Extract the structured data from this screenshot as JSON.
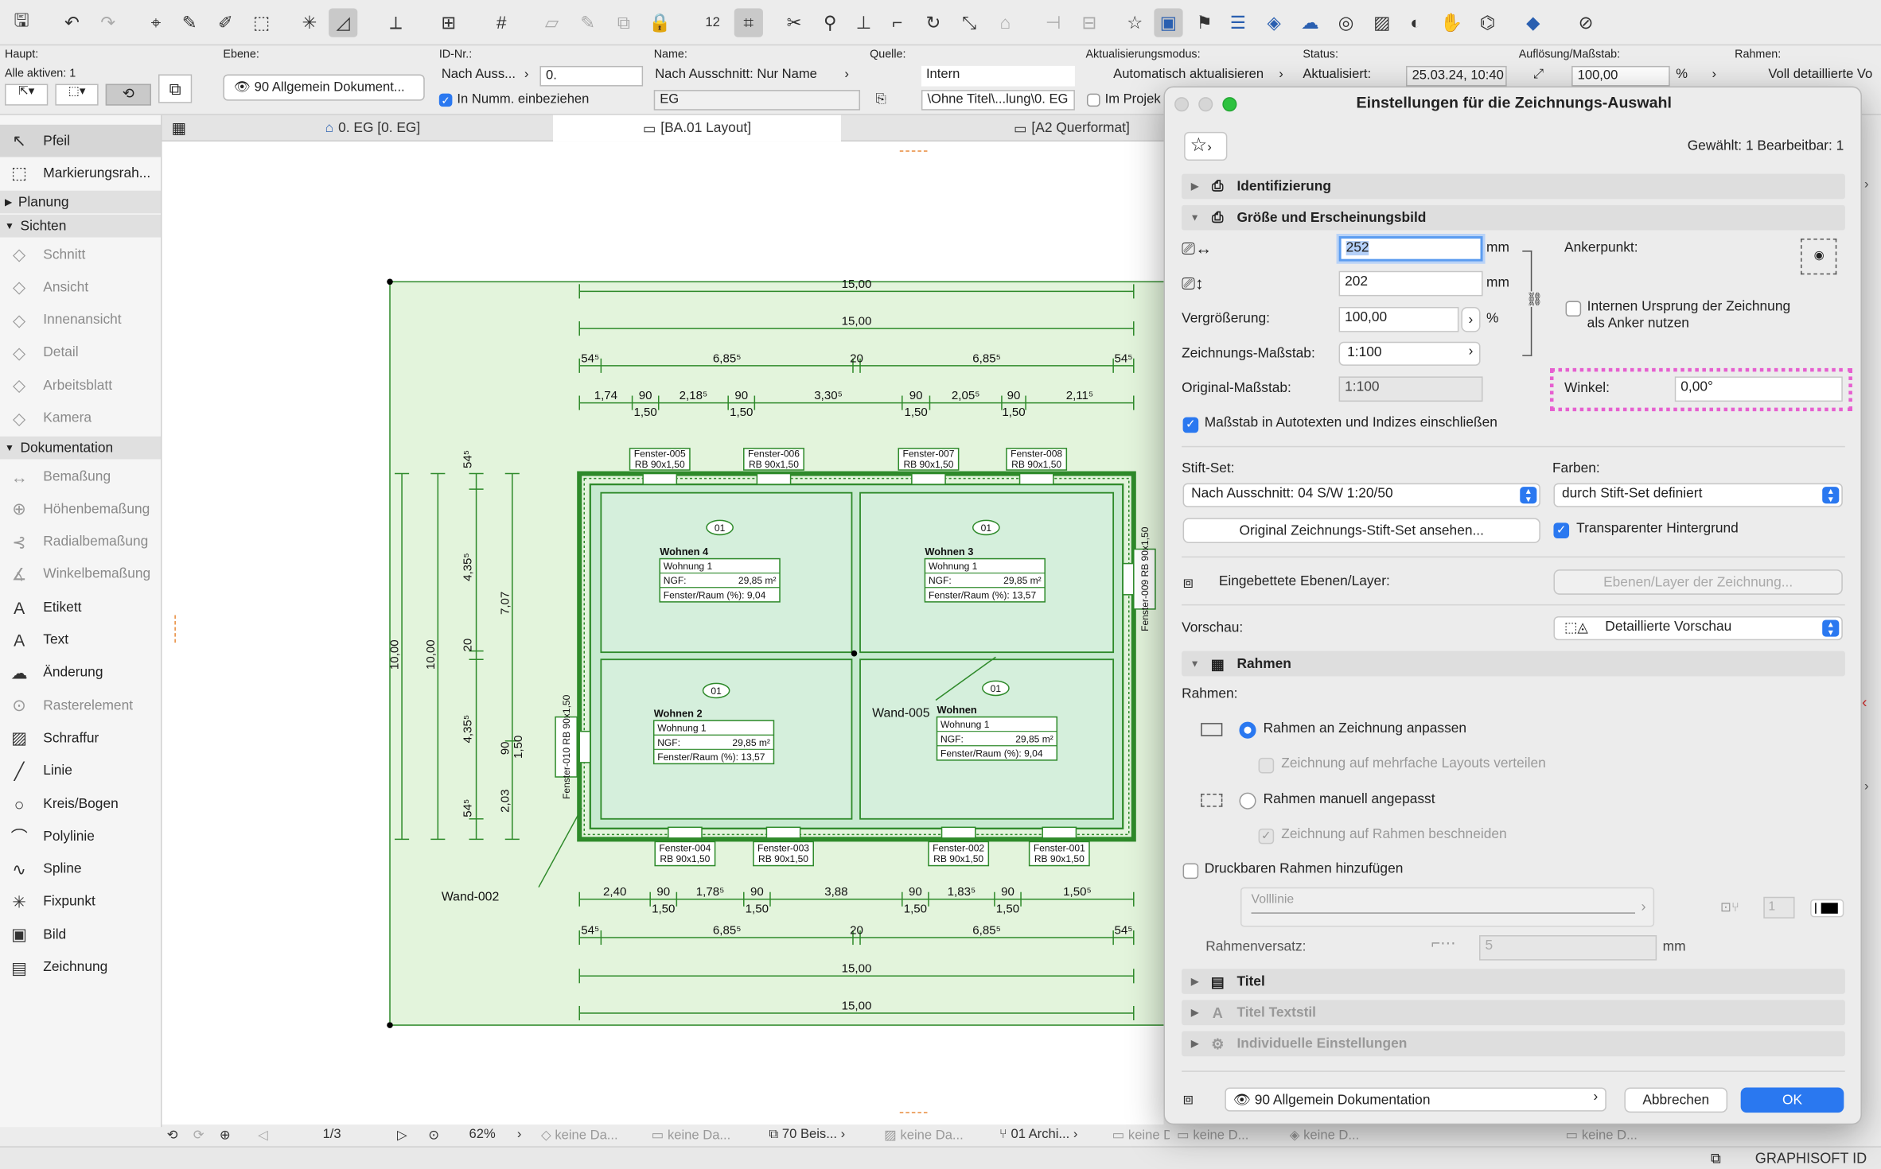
{
  "toolbar": {
    "icons": [
      "save-icon",
      "undo-icon",
      "redo-icon",
      "select-icon",
      "pick-icon",
      "inject-icon",
      "transform-icon",
      "cursor-icon",
      "guide-icon",
      "snap-icon",
      "grid-icon",
      "layer-icon",
      "lock-icon",
      "number-icon",
      "selection-icon",
      "trim-icon",
      "magic-icon",
      "elevate-icon",
      "offset-icon",
      "rotate-icon",
      "scale-icon",
      "favorites-icon",
      "flag-icon",
      "stack-icon",
      "graphics-icon"
    ]
  },
  "infobox": {
    "haupt_label": "Haupt:",
    "alle_aktiven": "Alle aktiven: 1",
    "ebene_label": "Ebene:",
    "ebene_value": "90 Allgemein Dokument...",
    "id_label": "ID-Nr.:",
    "id_by": "Nach Auss...",
    "id_value": "0.",
    "in_numm": "In Numm. einbeziehen",
    "name_label": "Name:",
    "name_by": "Nach Ausschnitt: Nur Name",
    "name_value": "EG",
    "quelle_label": "Quelle:",
    "quelle_value": "Intern",
    "quelle_path": "\\Ohne Titel\\...lung\\0. EG",
    "im_projekt": "Im Projek",
    "update_label": "Aktualisierungsmodus:",
    "update_value": "Automatisch aktualisieren",
    "status_label": "Status:",
    "status_value": "Aktualisiert:",
    "status_date": "25.03.24, 10:40",
    "res_label": "Auflösung/Maßstab:",
    "res_value": "100,00",
    "res_unit": "%",
    "frame_label": "Rahmen:",
    "frame_value": "Voll detaillierte Vo"
  },
  "tabs": [
    {
      "label": "0. EG [0. EG]"
    },
    {
      "label": "[BA.01 Layout]"
    },
    {
      "label": "[A2 Querformat]"
    }
  ],
  "toolbox": {
    "items_top": [
      {
        "label": "Pfeil",
        "icon": "arrow-icon"
      },
      {
        "label": "Markierungsrah...",
        "icon": "marquee-icon"
      }
    ],
    "sections": [
      "Planung",
      "Sichten",
      "Dokumentation"
    ],
    "sichten": [
      {
        "label": "Schnitt",
        "icon": "section-icon"
      },
      {
        "label": "Ansicht",
        "icon": "elevation-icon"
      },
      {
        "label": "Innenansicht",
        "icon": "interior-icon"
      },
      {
        "label": "Detail",
        "icon": "detail-icon"
      },
      {
        "label": "Arbeitsblatt",
        "icon": "worksheet-icon"
      },
      {
        "label": "Kamera",
        "icon": "camera-icon"
      }
    ],
    "dokumentation": [
      {
        "label": "Bemaßung",
        "icon": "dimension-icon",
        "dim": true
      },
      {
        "label": "Höhenbemaßung",
        "icon": "level-dimension-icon",
        "dim": true
      },
      {
        "label": "Radialbemaßung",
        "icon": "radial-dimension-icon",
        "dim": true
      },
      {
        "label": "Winkelbemaßung",
        "icon": "angle-dimension-icon",
        "dim": true
      },
      {
        "label": "Etikett",
        "icon": "label-icon",
        "dim": false
      },
      {
        "label": "Text",
        "icon": "text-icon",
        "dim": false
      },
      {
        "label": "Änderung",
        "icon": "change-icon",
        "dim": false
      },
      {
        "label": "Rasterelement",
        "icon": "grid-element-icon",
        "dim": true
      },
      {
        "label": "Schraffur",
        "icon": "fill-icon",
        "dim": false
      },
      {
        "label": "Linie",
        "icon": "line-icon",
        "dim": false
      },
      {
        "label": "Kreis/Bogen",
        "icon": "arc-icon",
        "dim": false
      },
      {
        "label": "Polylinie",
        "icon": "polyline-icon",
        "dim": false
      },
      {
        "label": "Spline",
        "icon": "spline-icon",
        "dim": false
      },
      {
        "label": "Fixpunkt",
        "icon": "hotspot-icon",
        "dim": false
      },
      {
        "label": "Bild",
        "icon": "image-icon",
        "dim": false
      },
      {
        "label": "Zeichnung",
        "icon": "drawing-icon",
        "dim": false
      }
    ]
  },
  "plan": {
    "dims_top": [
      "15,00",
      "15,00"
    ],
    "dims_row3": [
      "54⁵",
      "6,85⁵",
      "20",
      "6,85⁵",
      "54⁵"
    ],
    "dims_row4": [
      "1,74",
      "90",
      "2,18⁵",
      "90",
      "3,30⁵",
      "90",
      "2,05⁵",
      "90",
      "2,11⁵"
    ],
    "dims_row4_sub": [
      "1,50",
      "1,50",
      "1,50",
      "1,50"
    ],
    "dims_bottom1": [
      "2,40",
      "90",
      "1,78⁵",
      "90",
      "3,88",
      "90",
      "1,83⁵",
      "90",
      "1,50⁵"
    ],
    "dims_bottom1_sub": [
      "1,50",
      "1,50",
      "1,50",
      "1,50"
    ],
    "dims_bottom2": [
      "54⁵",
      "6,85⁵",
      "20",
      "6,85⁵",
      "54⁵"
    ],
    "dims_bottom3": [
      "15,00",
      "15,00"
    ],
    "dims_left": [
      "10,00",
      "10,00",
      "54⁵",
      "4,35⁵",
      "20",
      "4,35⁵",
      "54⁵",
      "7,07",
      "1,50",
      "90",
      "2,03"
    ],
    "windows_top": [
      {
        "name": "Fenster-005",
        "spec": "RB  90x1,50"
      },
      {
        "name": "Fenster-006",
        "spec": "RB  90x1,50"
      },
      {
        "name": "Fenster-007",
        "spec": "RB  90x1,50"
      },
      {
        "name": "Fenster-008",
        "spec": "RB  90x1,50"
      }
    ],
    "windows_bottom": [
      {
        "name": "Fenster-004",
        "spec": "RB  90x1,50"
      },
      {
        "name": "Fenster-003",
        "spec": "RB  90x1,50"
      },
      {
        "name": "Fenster-002",
        "spec": "RB  90x1,50"
      },
      {
        "name": "Fenster-001",
        "spec": "RB  90x1,50"
      }
    ],
    "window_left": "Fenster-010 RB  90x1,50",
    "window_right": "Fenster-009 RB  90x1,50",
    "rooms": [
      {
        "tag": "01",
        "name": "Wohnen 4",
        "unit": "Wohnung 1",
        "ngf_label": "NGF:",
        "ngf": "29,85 m²",
        "ratio": "Fenster/Raum (%): 9,04"
      },
      {
        "tag": "01",
        "name": "Wohnen 3",
        "unit": "Wohnung 1",
        "ngf_label": "NGF:",
        "ngf": "29,85 m²",
        "ratio": "Fenster/Raum (%): 13,57"
      },
      {
        "tag": "01",
        "name": "Wohnen 2",
        "unit": "Wohnung 1",
        "ngf_label": "NGF:",
        "ngf": "29,85 m²",
        "ratio": "Fenster/Raum (%): 13,57"
      },
      {
        "tag": "01",
        "name": "Wohnen",
        "unit": "Wohnung 1",
        "ngf_label": "NGF:",
        "ngf": "29,85 m²",
        "ratio": "Fenster/Raum (%): 9,04"
      }
    ],
    "wall_labels": [
      "Wand-005",
      "Wand-002"
    ]
  },
  "status": {
    "page": "1/3",
    "zoom": "62%",
    "items": [
      "keine Da...",
      "keine Da...",
      "70 Beis...",
      "keine Da...",
      "01 Archi...",
      "keine D...",
      "keine D...",
      "keine D...",
      "keine D..."
    ]
  },
  "footer": {
    "brand": "GRAPHISOFT ID"
  },
  "dialog": {
    "title": "Einstellungen für die Zeichnungs-Auswahl",
    "selected": "Gewählt: 1 Bearbeitbar: 1",
    "sec_identification": "Identifizierung",
    "sec_size": "Größe und Erscheinungsbild",
    "width": "252",
    "height": "202",
    "unit_mm": "mm",
    "anchor_label": "Ankerpunkt:",
    "internal_origin": "Internen Ursprung der Zeichnung",
    "internal_origin2": "als Anker nutzen",
    "magnification_label": "Vergrößerung:",
    "magnification": "100,00",
    "percent": "%",
    "drawing_scale_label": "Zeichnungs-Maßstab:",
    "drawing_scale": "1:100",
    "original_scale_label": "Original-Maßstab:",
    "original_scale": "1:100",
    "angle_label": "Winkel:",
    "angle": "0,00°",
    "include_scale": "Maßstab in Autotexten und Indizes einschließen",
    "penset_label": "Stift-Set:",
    "penset": "Nach Ausschnitt: 04 S/W 1:20/50",
    "colors_label": "Farben:",
    "colors": "durch Stift-Set definiert",
    "view_penset": "Original Zeichnungs-Stift-Set ansehen...",
    "transparent_bg": "Transparenter Hintergrund",
    "embedded_layers": "Eingebettete Ebenen/Layer:",
    "layers_button": "Ebenen/Layer der Zeichnung...",
    "preview_label": "Vorschau:",
    "preview": "Detaillierte Vorschau",
    "sec_frame": "Rahmen",
    "frame_label": "Rahmen:",
    "frame_fit": "Rahmen an Zeichnung anpassen",
    "distribute": "Zeichnung auf mehrfache Layouts verteilen",
    "frame_manual": "Rahmen manuell angepasst",
    "crop": "Zeichnung auf Rahmen beschneiden",
    "printable": "Druckbaren Rahmen hinzufügen",
    "line_type": "Volllinie",
    "pen_number": "1",
    "offset_label": "Rahmenversatz:",
    "offset": "5",
    "sec_title": "Titel",
    "sec_title_style": "Titel Textstil",
    "sec_custom": "Individuelle Einstellungen",
    "layer": "90 Allgemein Dokumentation",
    "cancel": "Abbrechen",
    "ok": "OK"
  },
  "colors": {
    "accent": "#2a78f0",
    "highlight": "#e65fd0",
    "plan_fill": "#dff3d8",
    "plan_line": "#2e8a2a"
  }
}
